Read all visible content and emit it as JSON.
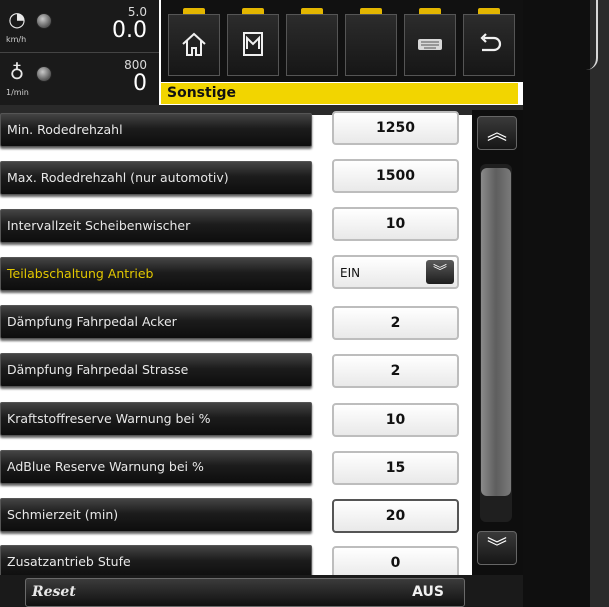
{
  "status": {
    "speed": {
      "icon": "speedometer-icon",
      "unit": "km/h",
      "max": "5.0",
      "value": "0.0"
    },
    "rpm": {
      "icon": "engine-rpm-icon",
      "unit": "1/min",
      "max": "800",
      "value": "0"
    }
  },
  "toolbar": {
    "buttons": [
      {
        "icon": "home-icon"
      },
      {
        "icon": "menu-m-icon"
      },
      {
        "icon": "empty-slot"
      },
      {
        "icon": "empty-slot"
      },
      {
        "icon": "keyboard-icon"
      },
      {
        "icon": "back-arrow-icon"
      }
    ]
  },
  "page_title": "Sonstige",
  "rows": [
    {
      "label": "Min. Rodedrehzahl",
      "value": "1250"
    },
    {
      "label": "Max. Rodedrehzahl (nur automotiv)",
      "value": "1500"
    },
    {
      "label": "Intervallzeit Scheibenwischer",
      "value": "10"
    },
    {
      "label": "Teilabschaltung Antrieb",
      "value": "EIN",
      "type": "dropdown",
      "highlight": true
    },
    {
      "label": "Dämpfung Fahrpedal Acker",
      "value": "2"
    },
    {
      "label": "Dämpfung Fahrpedal Strasse",
      "value": "2"
    },
    {
      "label": "Kraftstoffreserve Warnung bei %",
      "value": "10"
    },
    {
      "label": "AdBlue Reserve Warnung bei %",
      "value": "15"
    },
    {
      "label": "Schmierzeit (min)",
      "value": "20"
    },
    {
      "label": "Zusatzantrieb Stufe",
      "value": "0"
    }
  ],
  "bottom": {
    "reset_label": "Reset",
    "reset_value": "AUS"
  },
  "colors": {
    "accent_yellow": "#f2d500",
    "panel_dark": "#1a1a1a",
    "highlight_text": "#e3c800"
  }
}
